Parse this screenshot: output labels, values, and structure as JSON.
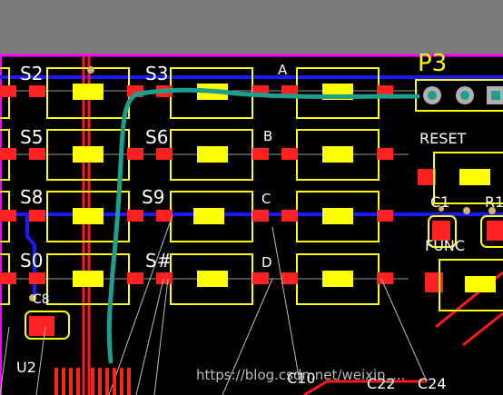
{
  "colors": {
    "background": "#000000",
    "top_band": "#7b7b7b",
    "board_edge": "#ff00ff",
    "pad": "#ff2020",
    "component_outline": "#ffff00",
    "component_body": "#ffff00",
    "trace_blue": "#1a1aff",
    "trace_red": "#ff1a1a",
    "trace_teal": "#1f9e8e",
    "ratsnest": "#bdbdbd",
    "label": "#ffffff",
    "header_label": "#ffff00"
  },
  "labels": {
    "header_connector": "P3",
    "switches": [
      "S2",
      "S3",
      "S5",
      "S6",
      "S8",
      "S9",
      "S0",
      "S#"
    ],
    "rows": [
      "A",
      "B",
      "C",
      "D"
    ],
    "reset": "RESET",
    "func": "FUNC",
    "caps": [
      "C1",
      "R1",
      "C8",
      "C10",
      "C22",
      "C24"
    ],
    "ic": "U2"
  },
  "watermark": "https://blog.csdn.net/weixin_..."
}
